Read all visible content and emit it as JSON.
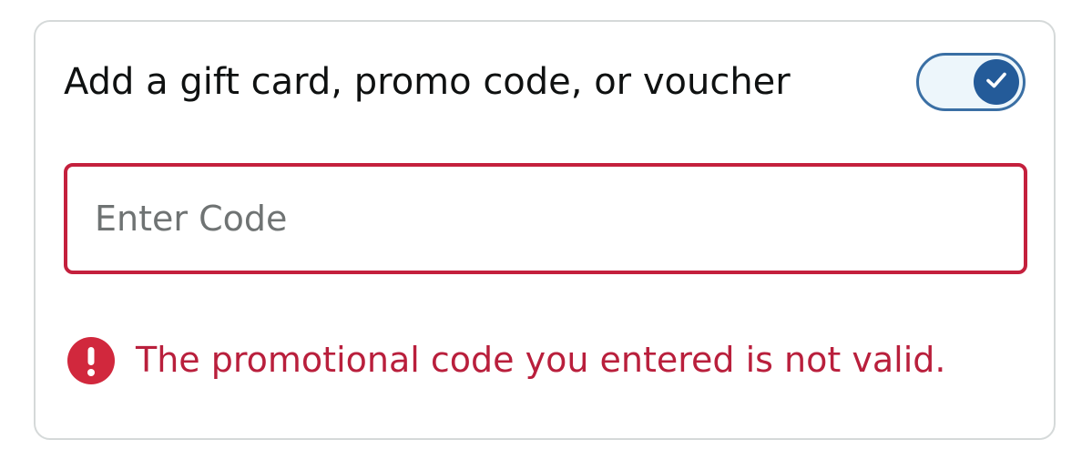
{
  "gift_card_section": {
    "title": "Add a gift card, promo code, or voucher",
    "toggle": {
      "state": "on",
      "icon": "checkmark-icon"
    },
    "code_input": {
      "value": "",
      "placeholder": "Enter Code"
    },
    "error": {
      "icon": "exclamation-circle-icon",
      "message": "The promotional code you entered is not valid."
    }
  },
  "colors": {
    "border": "#d5d9d9",
    "title_text": "#0f1111",
    "toggle_track": "#edf6fb",
    "toggle_border": "#3a6fa4",
    "toggle_knob": "#245b99",
    "error_red": "#c4203d",
    "error_text": "#b91f3c",
    "placeholder": "#6f7373"
  }
}
